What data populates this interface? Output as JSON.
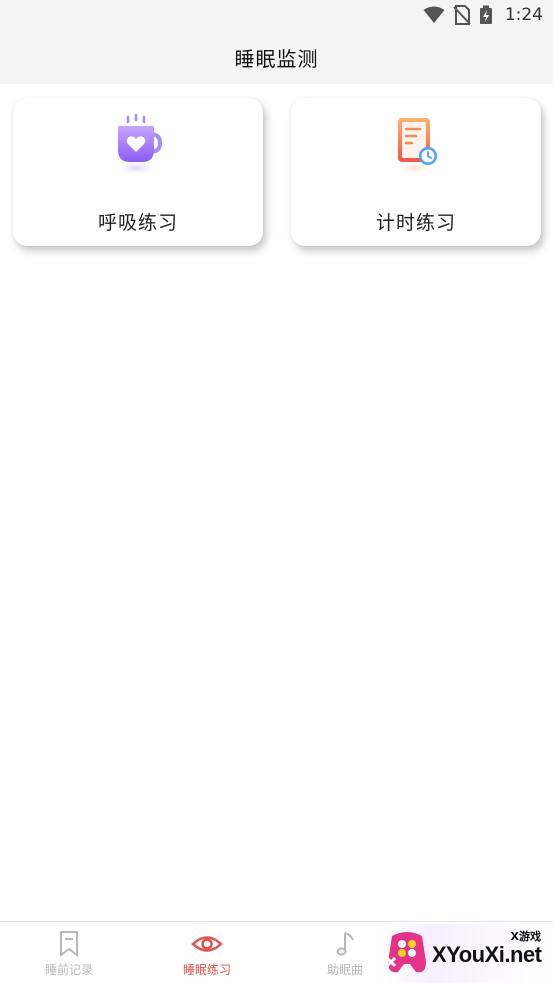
{
  "status": {
    "time": "1:24"
  },
  "header": {
    "title": "睡眠监测"
  },
  "cards": [
    {
      "label": "呼吸练习",
      "icon": "breathing-cup-icon"
    },
    {
      "label": "计时练习",
      "icon": "timer-document-icon"
    }
  ],
  "tabbar": {
    "tabs": [
      {
        "label": "睡前记录",
        "icon": "bookmark-icon",
        "active": false
      },
      {
        "label": "睡眠练习",
        "icon": "eye-icon",
        "active": true
      },
      {
        "label": "助眠曲",
        "icon": "music-note-icon",
        "active": false
      }
    ]
  },
  "watermark": {
    "small": "X游戏",
    "big": "XYouXi.net"
  },
  "colors": {
    "accent": "#e0534f",
    "inactive": "#b8b8b8",
    "background": "#f5f5f5"
  }
}
